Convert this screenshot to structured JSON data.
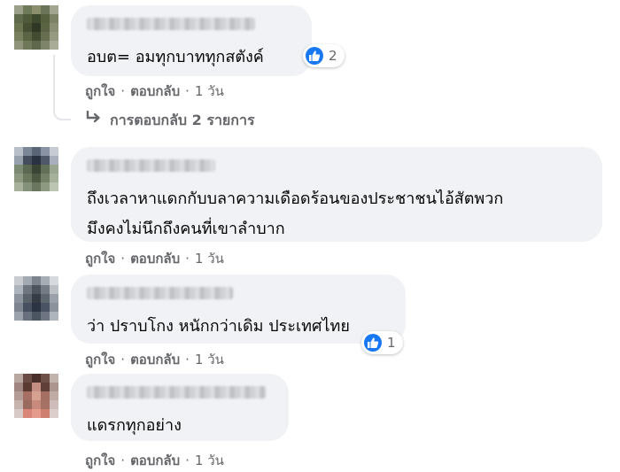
{
  "comments": [
    {
      "text": "อบต= อมทุกบาททุกสตังค์",
      "reaction_count": "2",
      "actions": {
        "like": "ถูกใจ",
        "reply": "ตอบกลับ",
        "time": "1 วัน"
      },
      "replies_label": "การตอบกลับ 2 รายการ"
    },
    {
      "text_lines": [
        "ถึงเวลาหาแดกกับบลาความเดือดร้อนของประชาชนไอ้สัตพวก",
        "มึงคงไม่นึกถึงคนที่เขาลำบาก"
      ],
      "actions": {
        "like": "ถูกใจ",
        "reply": "ตอบกลับ",
        "time": "1 วัน"
      }
    },
    {
      "text": "ว่า ปราบโกง หนักกว่าเดิม ประเทศไทย",
      "reaction_count": "1",
      "actions": {
        "like": "ถูกใจ",
        "reply": "ตอบกลับ",
        "time": "1 วัน"
      }
    },
    {
      "text": "แดรกทุกอย่าง",
      "actions": {
        "like": "ถูกใจ",
        "reply": "ตอบกลับ",
        "time": "1 วัน"
      }
    }
  ],
  "separator": "·",
  "icons": {
    "like": "thumbs-up-icon",
    "reply_arrow": "reply-arrow-icon"
  },
  "colors": {
    "like_blue": "#1877f2",
    "bubble": "#f0f2f5",
    "meta_text": "#65676b"
  }
}
